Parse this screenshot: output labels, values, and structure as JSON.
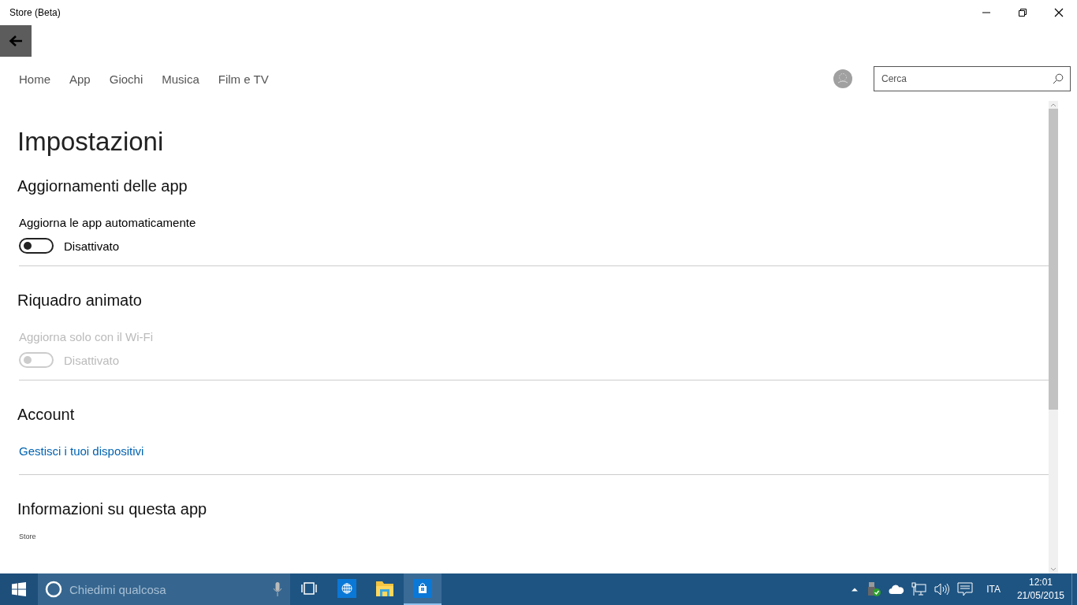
{
  "window": {
    "title": "Store (Beta)"
  },
  "nav": [
    "Home",
    "App",
    "Giochi",
    "Musica",
    "Film e TV"
  ],
  "search": {
    "placeholder": "Cerca"
  },
  "page_title": "Impostazioni",
  "sections": [
    {
      "heading": "Aggiornamenti delle app",
      "items": [
        {
          "kind": "toggle",
          "label": "Aggiorna le app automaticamente",
          "on": false,
          "disabled": false,
          "state_text": "Disattivato"
        }
      ]
    },
    {
      "heading": "Riquadro animato",
      "items": [
        {
          "kind": "toggle",
          "label": "Aggiorna solo con il Wi-Fi",
          "on": false,
          "disabled": true,
          "state_text": "Disattivato"
        }
      ]
    },
    {
      "heading": "Account",
      "items": [
        {
          "kind": "link",
          "label": "Gestisci i tuoi dispositivi"
        }
      ]
    },
    {
      "heading": "Informazioni su questa app",
      "items": [
        {
          "kind": "caption",
          "label": "Store"
        }
      ]
    }
  ],
  "taskbar": {
    "search_placeholder": "Chiedimi qualcosa",
    "apps": [
      {
        "kind": "task-view",
        "selected": false
      },
      {
        "kind": "browser",
        "selected": false
      },
      {
        "kind": "explorer",
        "selected": false
      },
      {
        "kind": "store",
        "selected": true
      }
    ],
    "language": "ITA",
    "time": "12:01",
    "date": "21/05/2015"
  }
}
